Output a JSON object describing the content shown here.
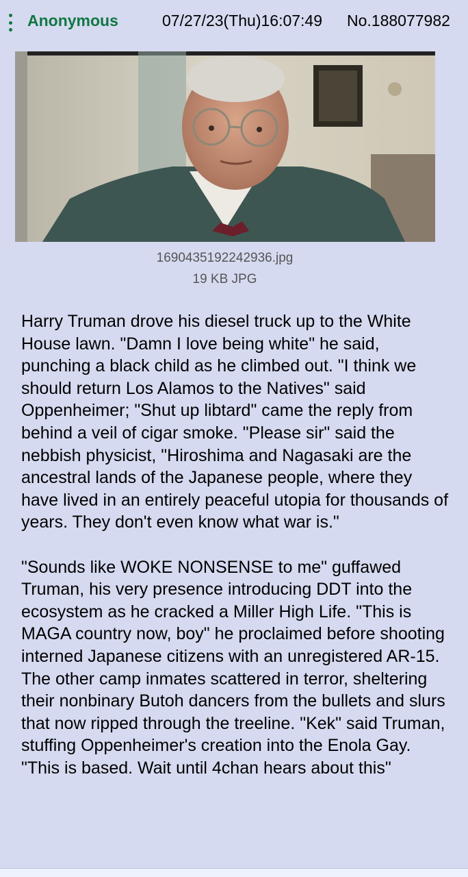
{
  "post": {
    "author": "Anonymous",
    "datetime": "07/27/23(Thu)16:07:49",
    "post_number": "No.188077982",
    "file": {
      "name": "1690435192242936.jpg",
      "info": "19 KB JPG"
    },
    "paragraphs": [
      "Harry Truman drove his diesel truck up to the White House lawn. \"Damn I love being white\" he said, punching a black child as he climbed out. \"I think we should return Los Alamos to the Natives\" said Oppenheimer; \"Shut up libtard\" came the reply from behind a veil of cigar smoke. \"Please sir\" said the nebbish physicist, \"Hiroshima and Nagasaki are the ancestral lands of the Japanese people, where they have lived in an entirely peaceful utopia for thousands of years. They don't even know what war is.\"",
      "\"Sounds like WOKE NONSENSE to me\" guffawed Truman, his very presence introducing DDT into the ecosystem as he cracked a Miller High Life. \"This is MAGA country now, boy\" he proclaimed before shooting interned Japanese citizens with an unregistered AR-15. The other camp inmates scattered in terror, sheltering their nonbinary Butoh dancers from the bullets and slurs that now ripped through the treeline. \"Kek\" said Truman, stuffing Oppenheimer's creation into the Enola Gay. \"This is based. Wait until 4chan hears about this\""
    ]
  },
  "colors": {
    "post_background": "#d6daf0",
    "name_green": "#117743",
    "file_info_gray": "#555555"
  },
  "icons": {
    "menu": "vertical-ellipsis-icon"
  }
}
